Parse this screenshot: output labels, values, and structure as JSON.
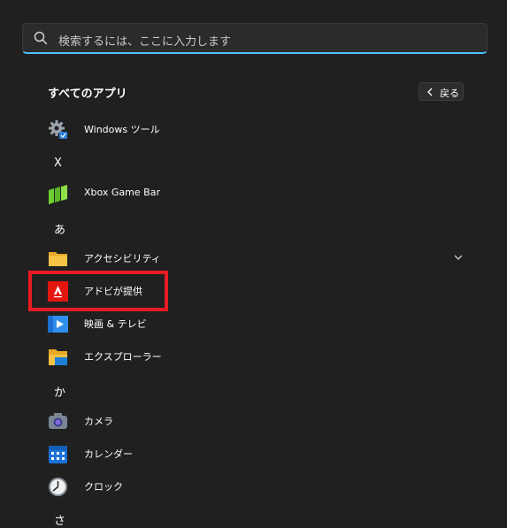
{
  "search": {
    "placeholder": "検索するには、ここに入力します",
    "icon": "search-icon"
  },
  "header": {
    "title": "すべてのアプリ",
    "back_label": "戻る"
  },
  "groups": {
    "x": "X",
    "a": "あ",
    "ka": "か",
    "sa": "さ"
  },
  "apps": [
    {
      "label": "Windows ツール",
      "icon": "windows-tools-icon"
    },
    {
      "label": "Xbox Game Bar",
      "icon": "xbox-game-bar-icon"
    },
    {
      "label": "アクセシビリティ",
      "icon": "folder-icon",
      "expandable": true
    },
    {
      "label": "アドビが提供",
      "icon": "adobe-icon",
      "highlighted": true,
      "highlight_color": "#e81b23"
    },
    {
      "label": "映画 & テレビ",
      "icon": "movies-tv-icon"
    },
    {
      "label": "エクスプローラー",
      "icon": "file-explorer-icon"
    },
    {
      "label": "カメラ",
      "icon": "camera-icon"
    },
    {
      "label": "カレンダー",
      "icon": "calendar-icon"
    },
    {
      "label": "クロック",
      "icon": "clock-icon"
    }
  ],
  "colors": {
    "accent": "#4cc2ff",
    "background": "#202020",
    "highlight": "#e81b23"
  }
}
